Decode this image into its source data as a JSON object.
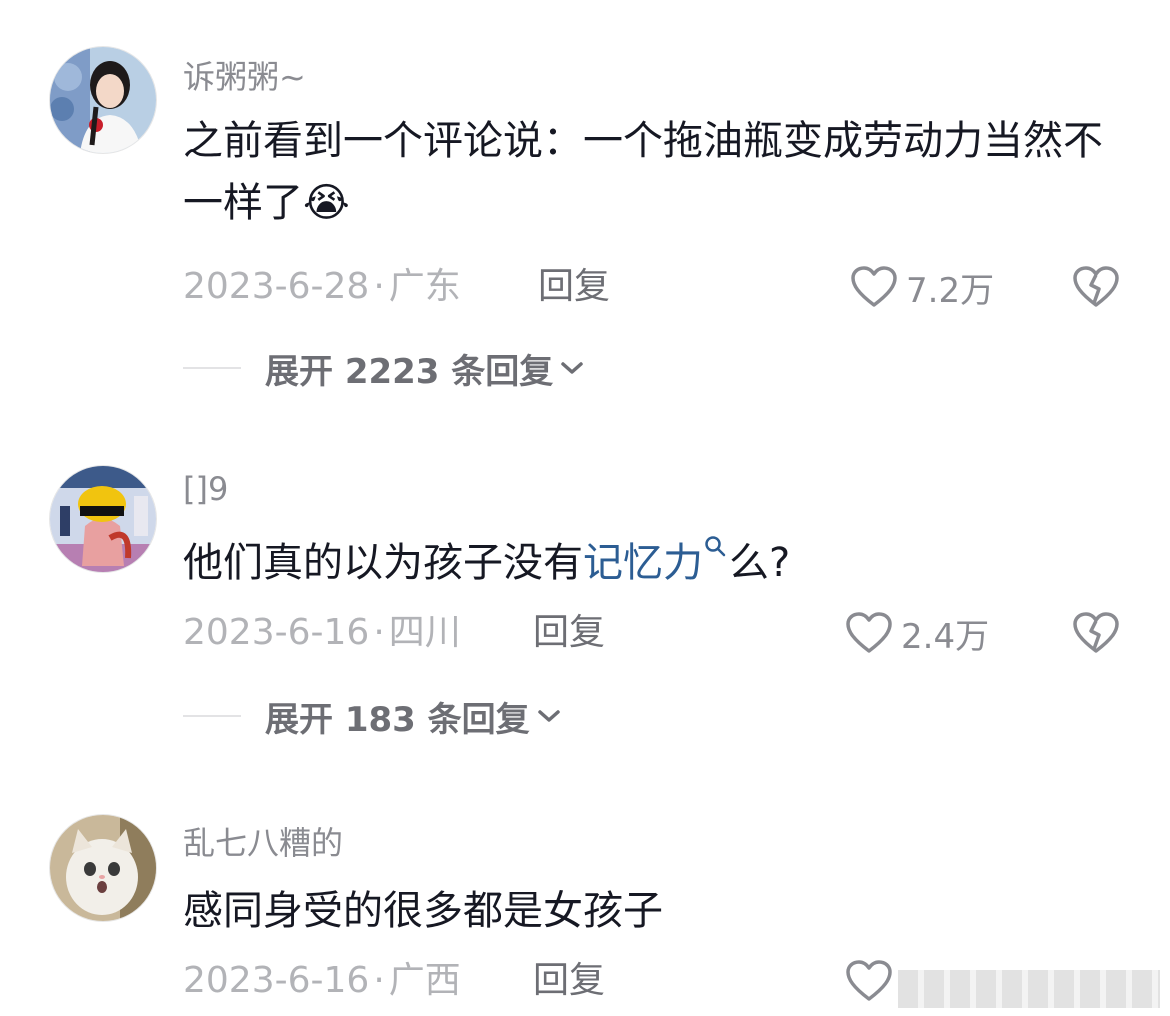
{
  "comments": [
    {
      "username": "诉粥粥~",
      "text_parts": [
        "之前看到一个评论说：一个拖油瓶变成劳动力当然不一样了",
        "😭"
      ],
      "date": "2023-6-28",
      "location": "广东",
      "reply_label": "回复",
      "likes": "7.2万",
      "expand_label": "展开 2223 条回复",
      "avatar_icon": "woman-portrait-avatar"
    },
    {
      "username": "[]9",
      "text_before": "他们真的以为孩子没有",
      "text_link": "记忆力",
      "text_after": "么?",
      "date": "2023-6-16",
      "location": "四川",
      "reply_label": "回复",
      "likes": "2.4万",
      "expand_label": "展开 183 条回复",
      "avatar_icon": "cartoon-character-avatar"
    },
    {
      "username": "乱七八糟的",
      "text": "感同身受的很多都是女孩子",
      "date": "2023-6-16",
      "location": "广西",
      "reply_label": "回复",
      "avatar_icon": "white-cat-avatar"
    }
  ],
  "meta_separator": "·",
  "colors": {
    "link": "#2c5d93",
    "username": "#8a8b91",
    "meta": "#b2b3b7",
    "text": "#161823"
  }
}
